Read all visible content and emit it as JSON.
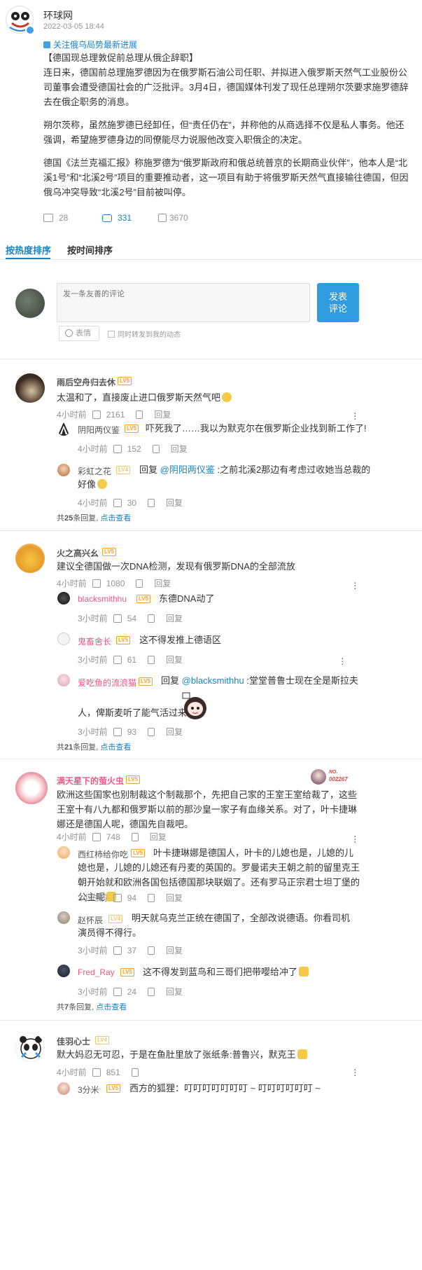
{
  "post": {
    "author": "环球网",
    "time": "2022-03-05 18:44",
    "topic": "关注俄乌局势最新进展",
    "headline": "【德国现总理敦促前总理从俄企辞职】",
    "p1": "连日来，德国前总理施罗德因为在俄罗斯石油公司任职、并拟进入俄罗斯天然气工业股份公司董事会遭受德国社会的广泛批评。3月4日，德国媒体刊发了现任总理朔尔茨要求施罗德辞去在俄企职务的消息。",
    "p2": "朔尔茨称，虽然施罗德已经卸任，但“责任仍在”，并称他的从商选择不仅是私人事务。他还强调，希望施罗德身边的同僚能尽力说服他改变入职俄企的决定。",
    "p3": "德国《法兰克福汇报》称施罗德为“俄罗斯政府和俄总统普京的长期商业伙伴”，他本人是“北溪1号”和“北溪2号”项目的重要推动者，这一项目有助于将俄罗斯天然气直接输往德国，但因俄乌冲突导致“北溪2号”目前被叫停。",
    "reposts": "28",
    "comments": "331",
    "likes": "3670"
  },
  "tabs": {
    "hot": "按热度排序",
    "time": "按时间排序"
  },
  "composer": {
    "placeholder": "发一条友善的评论",
    "submit_line1": "发表",
    "submit_line2": "评论",
    "emoji": "表情",
    "forward": "同时转发到我的动态"
  },
  "labels": {
    "reply": "回复",
    "view": "点击查看"
  },
  "comments": [
    {
      "user": "雨后空舟归去休",
      "level": "LV5",
      "text": "太温和了，直接废止进口俄罗斯天然气吧",
      "time": "4小时前",
      "likes": "2161",
      "replies": [
        {
          "user": "阴阳两仪鉴",
          "level": "LV5",
          "text": "吓死我了……我以为默克尔在俄罗斯企业找到新工作了!",
          "time": "4小时前",
          "likes": "152"
        },
        {
          "user": "彩虹之花",
          "level": "LV4",
          "reply_to": "@阴阳两仪鉴",
          "text_a": ":之前北溪2那边有考虑过收她当总裁的",
          "text_b": "好像",
          "time": "4小时前",
          "likes": "30"
        }
      ],
      "total_pre": "共",
      "total_num": "25",
      "total_post": "条回复,"
    },
    {
      "user": "火之高兴幺",
      "level": "LV5",
      "text": "建议全德国做一次DNA检测，发现有俄罗斯DNA的全部流放",
      "time": "4小时前",
      "likes": "1080",
      "replies": [
        {
          "user": "blacksmithhu",
          "level": "LV5",
          "text": "东德DNA动了",
          "time": "3小时前",
          "likes": "54"
        },
        {
          "user": "鬼畜舍长",
          "level": "LV5",
          "text": "这不得发推上德语区",
          "time": "3小时前",
          "likes": "61"
        },
        {
          "user": "爱吃鱼的流浪猫",
          "level": "LV5",
          "reply_to": "@blacksmithhu",
          "text_a": ":堂堂普鲁士现在全是斯拉夫",
          "text_b": "人，俾斯麦听了能气活过来",
          "time": "3小时前",
          "likes": "93"
        }
      ],
      "total_pre": "共",
      "total_num": "21",
      "total_post": "条回复,"
    },
    {
      "user": "满天星下的萤火虫",
      "level": "LV5",
      "badge_no": "NO.",
      "badge_num": "002267",
      "text": "欧洲这些国家也别制裁这个制裁那个，先把自己家的王室王室给裁了，这些王室十有八九都和俄罗斯以前的那沙皇一家子有血缘关系。对了，叶卡捷琳娜还是德国人呢，德国先自裁吧。",
      "time": "4小时前",
      "likes": "748",
      "replies": [
        {
          "user": "西红柿给你吃",
          "level": "LV5",
          "text": "叶卡捷琳娜是德国人，叶卡的儿媳也是，儿媳的儿媳也是，儿媳的儿媳还有丹麦的英国的。罗曼诺夫王朝之前的留里克王朝开始就和欧洲各国包括德国那块联姻了。还有罗马正宗君士坦丁堡的公主呢",
          "time": "3小时前",
          "likes": "94"
        },
        {
          "user": "赵怀辰",
          "level": "LV4",
          "text": "明天就乌克兰正统在德国了，全部改说德语。你看司机演员得不得行。",
          "time": "3小时前",
          "likes": "37"
        },
        {
          "user": "Fred_Ray",
          "level": "LV5",
          "text": "这不得发到蓝鸟和三哥们把带嘤给冲了",
          "time": "3小时前",
          "likes": "24"
        }
      ],
      "total_pre": "共",
      "total_num": "7",
      "total_post": "条回复,"
    },
    {
      "user": "佳羽心士",
      "level": "LV4",
      "text": "默大妈忍无可忍，于是在鱼肚里放了张纸条:普鲁兴，默克王",
      "time": "4小时前",
      "likes": "851",
      "replies": [
        {
          "user": "3分米",
          "level": "LV5",
          "text": "西方的狐狸：叮叮叮叮叮叮叮 ~ 叮叮叮叮叮叮 ~"
        }
      ]
    }
  ]
}
